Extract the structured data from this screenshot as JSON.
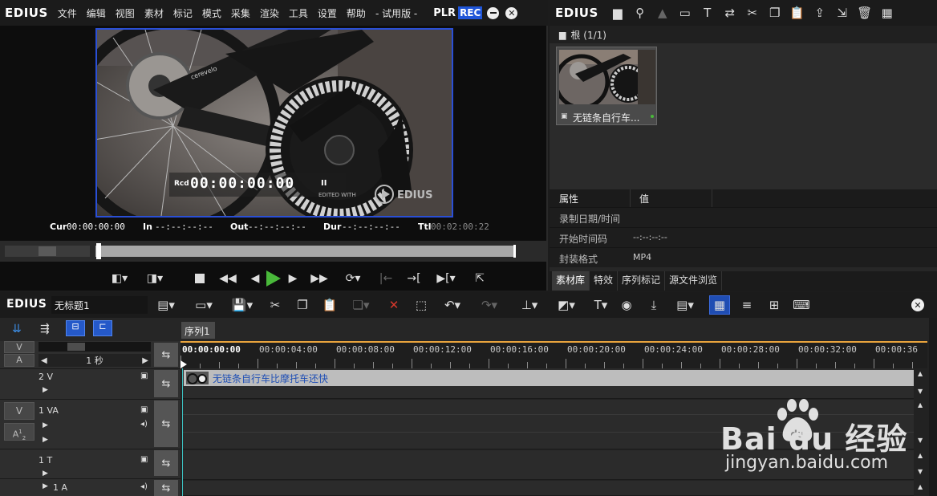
{
  "player": {
    "logo": "EDIUS",
    "menu": [
      "文件",
      "编辑",
      "视图",
      "素材",
      "标记",
      "模式",
      "采集",
      "渲染",
      "工具",
      "设置",
      "帮助",
      "- 试用版 -"
    ],
    "mode_plr": "PLR",
    "mode_rec": "REC",
    "overlay": {
      "rcd_label": "Rcd",
      "rcd_timecode": "00:00:00:00",
      "pause_glyph": "II",
      "watermark_text": "EDIUS",
      "watermark_small": "EDITED WITH"
    },
    "timecodes": {
      "cur_label": "Cur",
      "cur_value": "00:00:00:00",
      "in_label": "In",
      "in_value": "--:--:--:--",
      "out_label": "Out",
      "out_value": "--:--:--:--",
      "dur_label": "Dur",
      "dur_value": "--:--:--:--",
      "ttl_label": "Ttl",
      "ttl_value": "00:02:00:22"
    }
  },
  "bin": {
    "logo": "EDIUS",
    "folder_label": "根 (1/1)",
    "clip_name": "无链条自行车...",
    "properties": {
      "header_attr": "属性",
      "header_value": "值",
      "rows": [
        {
          "name": "录制日期/时间",
          "value": ""
        },
        {
          "name": "开始时间码",
          "value": "--:--:--:--"
        },
        {
          "name": "封装格式",
          "value": "MP4"
        }
      ]
    },
    "tabs": [
      "素材库",
      "特效",
      "序列标记",
      "源文件浏览"
    ]
  },
  "timeline": {
    "logo": "EDIUS",
    "project_name": "无标题1",
    "sequence_tab": "序列1",
    "zoom_label": "1 秒",
    "ruler_start": "00:00:00:00",
    "ruler_labels": [
      "00:00:04:00",
      "00:00:08:00",
      "00:00:12:00",
      "00:00:16:00",
      "00:00:20:00",
      "00:00:24:00",
      "00:00:28:00",
      "00:00:32:00",
      "00:00:36"
    ],
    "tracks": [
      {
        "name": "2 V"
      },
      {
        "name": "1 VA"
      },
      {
        "name": "1 T"
      },
      {
        "name": "1 A"
      }
    ],
    "track_v_label": "V",
    "track_a_label": "A",
    "track_a12_label": "A",
    "clip_title": "无链条自行车比摩托车还快"
  },
  "watermark": {
    "brand": "Bai du 经验",
    "url": "jingyan.baidu.com"
  },
  "colors": {
    "accent_blue": "#2a4fd6",
    "play_green": "#49b83a",
    "delete_red": "#d8382c",
    "ruler_orange": "#e8a33d"
  }
}
